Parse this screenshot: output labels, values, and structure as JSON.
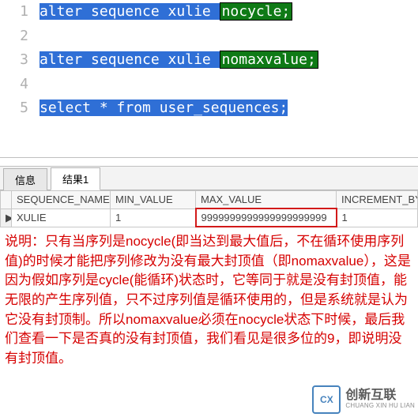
{
  "editor": {
    "lines": [
      {
        "num": "1",
        "leading": "",
        "keyword": "nocycle;",
        "text": "alter sequence xulie "
      },
      {
        "num": "2",
        "leading": "",
        "keyword": "",
        "text": ""
      },
      {
        "num": "3",
        "leading": "",
        "keyword": "nomaxvalue;",
        "text": "alter sequence xulie "
      },
      {
        "num": "4",
        "leading": "",
        "keyword": "",
        "text": ""
      },
      {
        "num": "5",
        "leading": "",
        "keyword": "",
        "text": "select * from user_sequences;"
      }
    ]
  },
  "tabs": {
    "info": "信息",
    "result": "结果1"
  },
  "table": {
    "headers": {
      "sequence_name": "SEQUENCE_NAME",
      "min_value": "MIN_VALUE",
      "max_value": "MAX_VALUE",
      "increment_by": "INCREMENT_BY"
    },
    "row_marker": "▶",
    "rows": [
      {
        "sequence_name": "XULIE",
        "min_value": "1",
        "max_value": "9999999999999999999999",
        "increment_by": "1"
      }
    ]
  },
  "explanation": "说明：只有当序列是nocycle(即当达到最大值后，不在循环使用序列值)的时候才能把序列修改为没有最大封顶值（即nomaxvalue），这是因为假如序列是cycle(能循环)状态时，它等同于就是没有封顶值，能无限的产生序列值，只不过序列值是循环使用的，但是系统就是认为它没有封顶制。所以nomaxvalue必须在nocycle状态下时候，最后我们查看一下是否真的没有封顶值，我们看见是很多位的9，即说明没有封顶值。",
  "watermark": {
    "logo_text": "CX",
    "brand_cn": "创新互联",
    "brand_en": "CHUANG XIN HU LIAN"
  }
}
